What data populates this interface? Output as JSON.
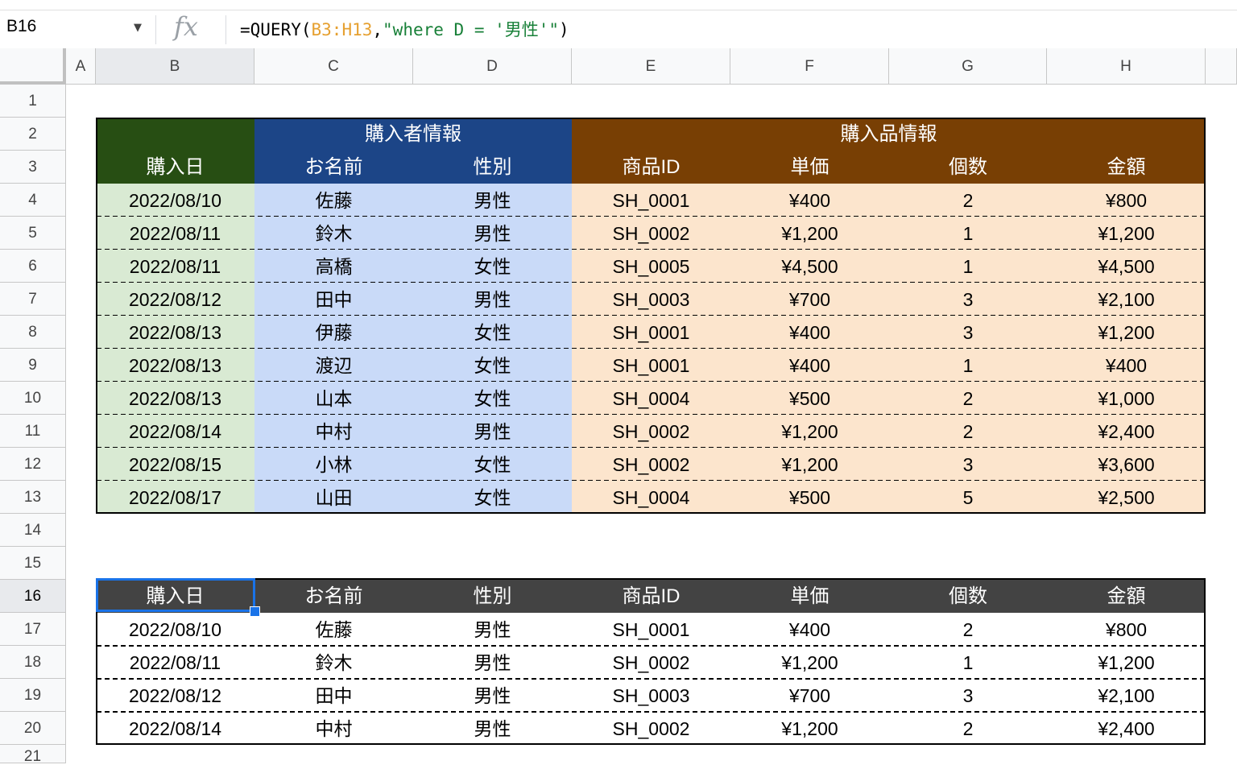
{
  "name_box": "B16",
  "fx_symbol": "fx",
  "dropdown_caret": "▼",
  "formula": {
    "prefix": "=QUERY(",
    "range": "B3:H13",
    "comma": ",",
    "query_str": "\"where D = '男性'\"",
    "suffix": ")"
  },
  "columns": [
    "A",
    "B",
    "C",
    "D",
    "E",
    "F",
    "G",
    "H"
  ],
  "rows": [
    "1",
    "2",
    "3",
    "4",
    "5",
    "6",
    "7",
    "8",
    "9",
    "10",
    "11",
    "12",
    "13",
    "14",
    "15",
    "16",
    "17",
    "18",
    "19",
    "20",
    "21"
  ],
  "table1": {
    "group_buyer": "購入者情報",
    "group_item": "購入品情報",
    "headers": [
      "購入日",
      "お名前",
      "性別",
      "商品ID",
      "単価",
      "個数",
      "金額"
    ],
    "rows": [
      [
        "2022/08/10",
        "佐藤",
        "男性",
        "SH_0001",
        "¥400",
        "2",
        "¥800"
      ],
      [
        "2022/08/11",
        "鈴木",
        "男性",
        "SH_0002",
        "¥1,200",
        "1",
        "¥1,200"
      ],
      [
        "2022/08/11",
        "高橋",
        "女性",
        "SH_0005",
        "¥4,500",
        "1",
        "¥4,500"
      ],
      [
        "2022/08/12",
        "田中",
        "男性",
        "SH_0003",
        "¥700",
        "3",
        "¥2,100"
      ],
      [
        "2022/08/13",
        "伊藤",
        "女性",
        "SH_0001",
        "¥400",
        "3",
        "¥1,200"
      ],
      [
        "2022/08/13",
        "渡辺",
        "女性",
        "SH_0001",
        "¥400",
        "1",
        "¥400"
      ],
      [
        "2022/08/13",
        "山本",
        "女性",
        "SH_0004",
        "¥500",
        "2",
        "¥1,000"
      ],
      [
        "2022/08/14",
        "中村",
        "男性",
        "SH_0002",
        "¥1,200",
        "2",
        "¥2,400"
      ],
      [
        "2022/08/15",
        "小林",
        "女性",
        "SH_0002",
        "¥1,200",
        "3",
        "¥3,600"
      ],
      [
        "2022/08/17",
        "山田",
        "女性",
        "SH_0004",
        "¥500",
        "5",
        "¥2,500"
      ]
    ]
  },
  "table2": {
    "headers": [
      "購入日",
      "お名前",
      "性別",
      "商品ID",
      "単価",
      "個数",
      "金額"
    ],
    "rows": [
      [
        "2022/08/10",
        "佐藤",
        "男性",
        "SH_0001",
        "¥400",
        "2",
        "¥800"
      ],
      [
        "2022/08/11",
        "鈴木",
        "男性",
        "SH_0002",
        "¥1,200",
        "1",
        "¥1,200"
      ],
      [
        "2022/08/12",
        "田中",
        "男性",
        "SH_0003",
        "¥700",
        "3",
        "¥2,100"
      ],
      [
        "2022/08/14",
        "中村",
        "男性",
        "SH_0002",
        "¥1,200",
        "2",
        "¥2,400"
      ]
    ]
  },
  "colors": {
    "date_header": "#274e13",
    "buyer_header": "#1c4587",
    "item_header": "#783f04",
    "date_fill": "#d9ead3",
    "buyer_fill": "#c9daf8",
    "item_fill": "#fce5cd",
    "result_header": "#434343",
    "selection": "#1a73e8"
  }
}
